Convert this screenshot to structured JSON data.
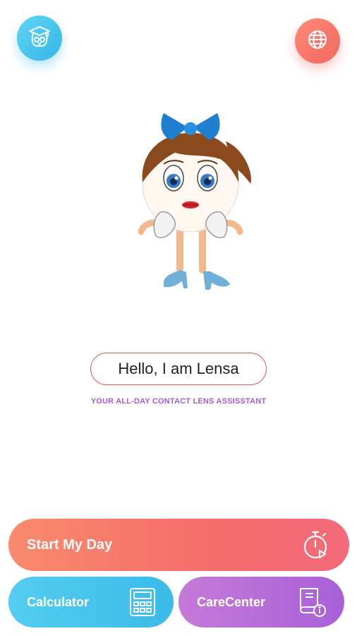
{
  "header": {
    "education_icon": "graduation-owl-icon",
    "language_icon": "globe-icon"
  },
  "mascot": {
    "name": "Lensa"
  },
  "greeting": "Hello, I am Lensa",
  "tagline": "YOUR ALL-DAY CONTACT LENS ASSISSTANT",
  "buttons": {
    "start_day": {
      "label": "Start My Day",
      "icon": "timer-play-icon"
    },
    "calculator": {
      "label": "Calculator",
      "icon": "calculator-icon"
    },
    "care_center": {
      "label": "CareCenter",
      "icon": "book-info-icon"
    }
  },
  "colors": {
    "blue": "#3bbbe9",
    "coral": "#f46d6b",
    "purple": "#a860d9"
  }
}
